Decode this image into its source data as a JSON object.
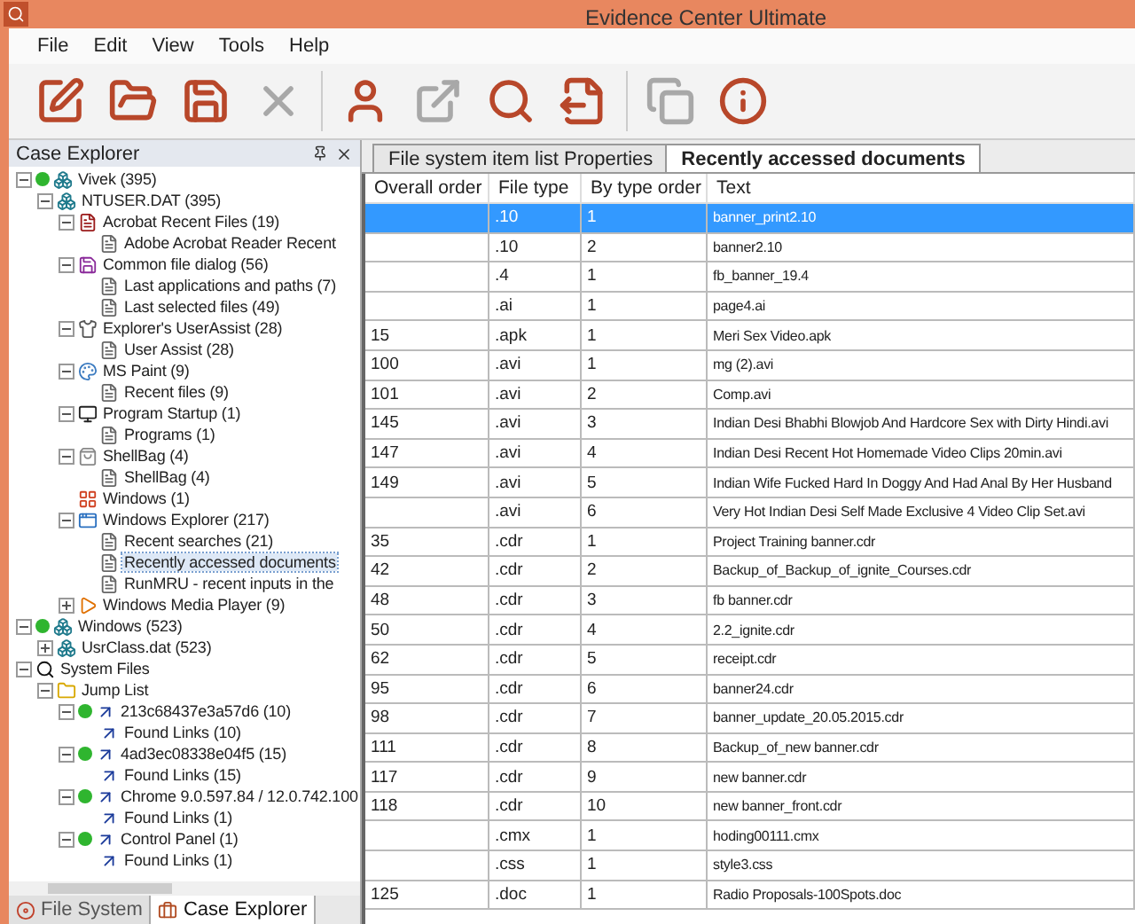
{
  "window": {
    "title": "Evidence Center Ultimate"
  },
  "menu": [
    "File",
    "Edit",
    "View",
    "Tools",
    "Help"
  ],
  "toolbar": [
    {
      "kind": "edit",
      "disabled": false
    },
    {
      "kind": "open",
      "disabled": false
    },
    {
      "kind": "save",
      "disabled": false
    },
    {
      "kind": "delete",
      "disabled": true
    },
    {
      "kind": "sep"
    },
    {
      "kind": "user",
      "disabled": false
    },
    {
      "kind": "export",
      "disabled": true
    },
    {
      "kind": "search",
      "disabled": false
    },
    {
      "kind": "report",
      "disabled": false
    },
    {
      "kind": "sep"
    },
    {
      "kind": "copy",
      "disabled": true
    },
    {
      "kind": "info",
      "disabled": false
    }
  ],
  "case_explorer": {
    "title": "Case Explorer",
    "tree": [
      {
        "label": "Vivek (395)",
        "kind": "registry",
        "online": true,
        "expanded": true,
        "selected": false,
        "children": [
          {
            "label": "NTUSER.DAT (395)",
            "kind": "registry",
            "expanded": true,
            "selected": false,
            "children": [
              {
                "label": "Acrobat Recent Files (19)",
                "kind": "acrobat",
                "expanded": true,
                "selected": false,
                "children": [
                  {
                    "label": "Adobe Acrobat Reader Recent",
                    "kind": "doc",
                    "selected": false
                  }
                ]
              },
              {
                "label": "Common file dialog (56)",
                "kind": "floppy",
                "expanded": true,
                "selected": false,
                "children": [
                  {
                    "label": "Last applications and paths (7)",
                    "kind": "doc",
                    "selected": false
                  },
                  {
                    "label": "Last selected files (49)",
                    "kind": "doc",
                    "selected": false
                  }
                ]
              },
              {
                "label": "Explorer's UserAssist (28)",
                "kind": "assist",
                "expanded": true,
                "selected": false,
                "children": [
                  {
                    "label": "User Assist (28)",
                    "kind": "doc",
                    "selected": false
                  }
                ]
              },
              {
                "label": "MS Paint (9)",
                "kind": "paint",
                "expanded": true,
                "selected": false,
                "children": [
                  {
                    "label": "Recent files (9)",
                    "kind": "doc",
                    "selected": false
                  }
                ]
              },
              {
                "label": "Program Startup (1)",
                "kind": "startup",
                "expanded": true,
                "selected": false,
                "children": [
                  {
                    "label": "Programs (1)",
                    "kind": "doc",
                    "selected": false
                  }
                ]
              },
              {
                "label": "ShellBag (4)",
                "kind": "bag",
                "expanded": true,
                "selected": false,
                "children": [
                  {
                    "label": "ShellBag (4)",
                    "kind": "doc",
                    "selected": false
                  }
                ]
              },
              {
                "label": "Windows (1)",
                "kind": "windows",
                "selected": false
              },
              {
                "label": "Windows Explorer (217)",
                "kind": "explorer",
                "expanded": true,
                "selected": false,
                "children": [
                  {
                    "label": "Recent searches (21)",
                    "kind": "doc",
                    "selected": false
                  },
                  {
                    "label": "Recently accessed documents",
                    "kind": "doc",
                    "selected": true
                  },
                  {
                    "label": "RunMRU - recent inputs in the",
                    "kind": "doc",
                    "selected": false
                  }
                ]
              },
              {
                "label": "Windows Media Player (9)",
                "kind": "media",
                "expanded": false,
                "selected": false
              }
            ]
          }
        ]
      },
      {
        "label": "Windows (523)",
        "kind": "registry",
        "online": true,
        "expanded": true,
        "selected": false,
        "children": [
          {
            "label": "UsrClass.dat (523)",
            "kind": "registry",
            "expanded": false,
            "selected": false
          }
        ]
      },
      {
        "label": "System Files",
        "kind": "search",
        "expanded": true,
        "selected": false,
        "children": [
          {
            "label": "Jump List",
            "kind": "folder",
            "expanded": true,
            "selected": false,
            "children": [
              {
                "label": "213c68437e3a57d6 (10)",
                "kind": "shortcut",
                "online": true,
                "expanded": true,
                "selected": false,
                "children": [
                  {
                    "label": "Found Links (10)",
                    "kind": "shortcut",
                    "selected": false
                  }
                ]
              },
              {
                "label": "4ad3ec08338e04f5 (15)",
                "kind": "shortcut",
                "online": true,
                "expanded": true,
                "selected": false,
                "children": [
                  {
                    "label": "Found Links (15)",
                    "kind": "shortcut",
                    "selected": false
                  }
                ]
              },
              {
                "label": "Chrome 9.0.597.84 / 12.0.742.100",
                "kind": "shortcut",
                "online": true,
                "expanded": true,
                "selected": false,
                "children": [
                  {
                    "label": "Found Links (1)",
                    "kind": "shortcut",
                    "selected": false
                  }
                ]
              },
              {
                "label": "Control Panel (1)",
                "kind": "shortcut",
                "online": true,
                "expanded": true,
                "selected": false,
                "children": [
                  {
                    "label": "Found Links (1)",
                    "kind": "shortcut",
                    "selected": false
                  }
                ]
              }
            ]
          }
        ]
      }
    ],
    "bottom_tabs": [
      {
        "label": "File System",
        "kind": "disk",
        "selected": false
      },
      {
        "label": "Case Explorer",
        "kind": "case",
        "selected": true
      }
    ]
  },
  "document_tabs": [
    {
      "label": "File system item list Properties",
      "selected": false
    },
    {
      "label": "Recently accessed documents",
      "selected": true
    }
  ],
  "table": {
    "columns": [
      "Overall order",
      "File type",
      "By type order",
      "Text"
    ],
    "rows": [
      {
        "cells": [
          "",
          ".10",
          "1",
          "banner_print2.10"
        ],
        "selected": true
      },
      {
        "cells": [
          "",
          ".10",
          "2",
          "banner2.10"
        ],
        "selected": false
      },
      {
        "cells": [
          "",
          ".4",
          "1",
          "fb_banner_19.4"
        ],
        "selected": false
      },
      {
        "cells": [
          "",
          ".ai",
          "1",
          "page4.ai"
        ],
        "selected": false
      },
      {
        "cells": [
          "15",
          ".apk",
          "1",
          "Meri Sex Video.apk"
        ],
        "selected": false
      },
      {
        "cells": [
          "100",
          ".avi",
          "1",
          "mg (2).avi"
        ],
        "selected": false
      },
      {
        "cells": [
          "101",
          ".avi",
          "2",
          "Comp.avi"
        ],
        "selected": false
      },
      {
        "cells": [
          "145",
          ".avi",
          "3",
          "Indian Desi Bhabhi Blowjob And Hardcore Sex with Dirty Hindi.avi"
        ],
        "selected": false
      },
      {
        "cells": [
          "147",
          ".avi",
          "4",
          "Indian Desi Recent Hot Homemade Video Clips 20min.avi"
        ],
        "selected": false
      },
      {
        "cells": [
          "149",
          ".avi",
          "5",
          "Indian Wife Fucked Hard In Doggy And Had Anal By Her Husband"
        ],
        "selected": false
      },
      {
        "cells": [
          "",
          ".avi",
          "6",
          "Very Hot Indian Desi Self Made Exclusive 4 Video Clip Set.avi"
        ],
        "selected": false
      },
      {
        "cells": [
          "35",
          ".cdr",
          "1",
          "Project Training banner.cdr"
        ],
        "selected": false
      },
      {
        "cells": [
          "42",
          ".cdr",
          "2",
          "Backup_of_Backup_of_ignite_Courses.cdr"
        ],
        "selected": false
      },
      {
        "cells": [
          "48",
          ".cdr",
          "3",
          "fb banner.cdr"
        ],
        "selected": false
      },
      {
        "cells": [
          "50",
          ".cdr",
          "4",
          "2.2_ignite.cdr"
        ],
        "selected": false
      },
      {
        "cells": [
          "62",
          ".cdr",
          "5",
          "receipt.cdr"
        ],
        "selected": false
      },
      {
        "cells": [
          "95",
          ".cdr",
          "6",
          "banner24.cdr"
        ],
        "selected": false
      },
      {
        "cells": [
          "98",
          ".cdr",
          "7",
          "banner_update_20.05.2015.cdr"
        ],
        "selected": false
      },
      {
        "cells": [
          "111",
          ".cdr",
          "8",
          "Backup_of_new banner.cdr"
        ],
        "selected": false
      },
      {
        "cells": [
          "117",
          ".cdr",
          "9",
          "new banner.cdr"
        ],
        "selected": false
      },
      {
        "cells": [
          "118",
          ".cdr",
          "10",
          "new banner_front.cdr"
        ],
        "selected": false
      },
      {
        "cells": [
          "",
          ".cmx",
          "1",
          "hoding00111.cmx"
        ],
        "selected": false
      },
      {
        "cells": [
          "",
          ".css",
          "1",
          "style3.css"
        ],
        "selected": false
      },
      {
        "cells": [
          "125",
          ".doc",
          "1",
          "Radio Proposals-100Spots.doc"
        ],
        "selected": false
      }
    ]
  }
}
